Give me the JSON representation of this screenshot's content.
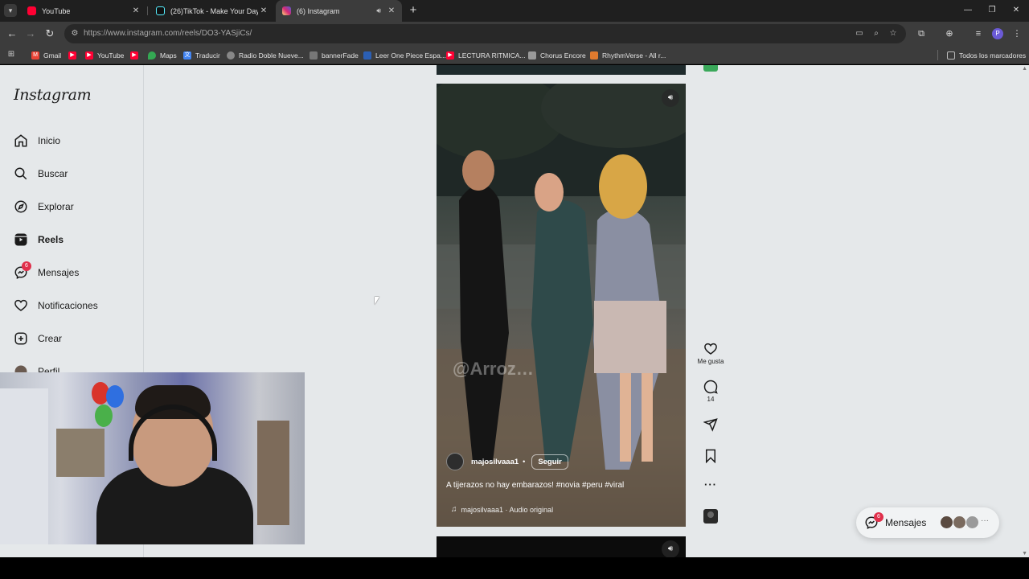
{
  "tabs": [
    {
      "title": "YouTube",
      "favicon_color": "#ff0033"
    },
    {
      "title": "(26)TikTok - Make Your Day",
      "favicon_color": "#111111"
    },
    {
      "title": "(6) Instagram",
      "favicon_color": "#d6249f"
    }
  ],
  "omnibox": {
    "url": "https://www.instagram.com/reels/DO3-YASjiCs/"
  },
  "bookmarks": [
    {
      "label": "Gmail",
      "color": "#ea4335"
    },
    {
      "label": "",
      "color": "#ff0033"
    },
    {
      "label": "YouTube",
      "color": "#ff0033"
    },
    {
      "label": "",
      "color": "#ff0033"
    },
    {
      "label": "Maps",
      "color": "#34a853"
    },
    {
      "label": "Traducir",
      "color": "#4285f4"
    },
    {
      "label": "Radio Doble Nueve...",
      "color": "#888888"
    },
    {
      "label": "bannerFade",
      "color": "#777777"
    },
    {
      "label": "Leer One Piece Espa...",
      "color": "#2b5fb4"
    },
    {
      "label": "LECTURA RITMICA...",
      "color": "#ff0033"
    },
    {
      "label": "Chorus Encore",
      "color": "#999999"
    },
    {
      "label": "RhythmVerse - All r...",
      "color": "#e07a2e"
    }
  ],
  "bookmarks_all": "Todos los marcadores",
  "sidebar": {
    "logo": "Instagram",
    "items": [
      {
        "label": "Inicio",
        "icon": "home-icon"
      },
      {
        "label": "Buscar",
        "icon": "search-icon"
      },
      {
        "label": "Explorar",
        "icon": "compass-icon"
      },
      {
        "label": "Reels",
        "icon": "reels-icon",
        "active": true
      },
      {
        "label": "Mensajes",
        "icon": "messenger-icon",
        "badge": "6"
      },
      {
        "label": "Notificaciones",
        "icon": "heart-icon"
      },
      {
        "label": "Crear",
        "icon": "plus-square-icon"
      },
      {
        "label": "Perfil",
        "icon": "avatar-icon"
      }
    ]
  },
  "reel": {
    "author": "majosilvaaa1",
    "follow_label": "Seguir",
    "caption": "A tijerazos no hay embarazos! #novia #peru #viral",
    "audio": "majosilvaaa1 · Audio original",
    "watermark": "@Arroz…"
  },
  "actions": {
    "like_label": "Me gusta",
    "comments_count": "14"
  },
  "messages_pill": {
    "label": "Mensajes",
    "badge": "6"
  },
  "colors": {
    "accent_badge": "#e0304b",
    "page_bg": "#e5e8ea",
    "chrome_bg": "#3c3c3c"
  }
}
